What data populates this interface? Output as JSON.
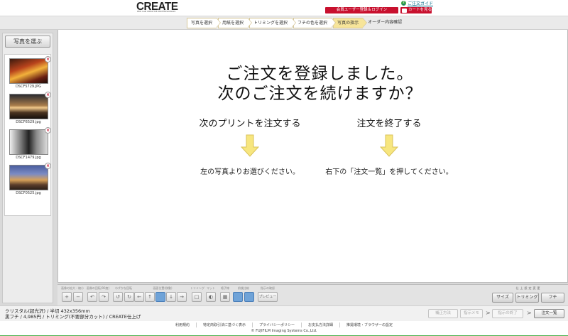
{
  "header": {
    "logo_text": "CREATE",
    "logo_sub": "PRO LAB CREATIVE PROFESSIONALS",
    "guide_link": "ご注文ガイド",
    "member_button": "会員ユーザー登録＆ログイン",
    "cart_button": "カートを見る"
  },
  "steps": [
    {
      "label": "写真を選択",
      "active": false
    },
    {
      "label": "用紙を選択",
      "active": false
    },
    {
      "label": "トリミングを選択",
      "active": false
    },
    {
      "label": "フチの色を選択",
      "active": false
    },
    {
      "label": "写真の指示",
      "active": true
    },
    {
      "label": "オーダー内容確認",
      "active": false
    }
  ],
  "sidebar": {
    "choose_button": "写真を選ぶ",
    "photos": [
      {
        "filename": "DSCF5729.JPG"
      },
      {
        "filename": "DSCF6529.jpg"
      },
      {
        "filename": "DSCF1479.jpg"
      },
      {
        "filename": "DSCF0525.jpg"
      }
    ]
  },
  "main": {
    "message_line1": "ご注文を登録しました。",
    "message_line2": "次のご注文を続けますか？",
    "left_heading": "次のプリントを注文する",
    "left_note": "左の写真よりお選びください。",
    "right_heading": "注文を終了する",
    "right_note": "右下の「注文一覧」を押してください。",
    "arrow_color": "#f5e27a"
  },
  "toolbar": {
    "labels": {
      "size_fit": "画像の拡大・縮小",
      "rotate": "画像の回転(90度)",
      "fine_rotate": "わずかな回転",
      "move": "画面位置(移動)",
      "trim": "トリミング",
      "mat": "マット",
      "grid": "格子線",
      "compare": "前後比較",
      "preview": "指示の確認"
    },
    "preview_button": "プレビュー",
    "right_label": "仕上設定変更",
    "size_button": "サイズ",
    "trim_button": "トリミング",
    "border_button": "フチ"
  },
  "infobar": {
    "line1": "クリスタル(超光沢) / 半切 432x356mm",
    "line2": "黒フチ / 4,985円 / トリミング(不要部分カット) / CREATE仕上げ",
    "btn_apply": "補正方法",
    "btn_memo": "指示メモ",
    "btn_finish": "指示の終了",
    "btn_list": "注文一覧"
  },
  "footer": {
    "links": [
      "利用規約",
      "特定商取引法に基づく表示",
      "プライバシーポリシー",
      "お支払方法詳細",
      "推奨環境・ブラウザーの設定"
    ],
    "copyright": "FUJIFILM Imaging Systems Co.,Ltd."
  }
}
